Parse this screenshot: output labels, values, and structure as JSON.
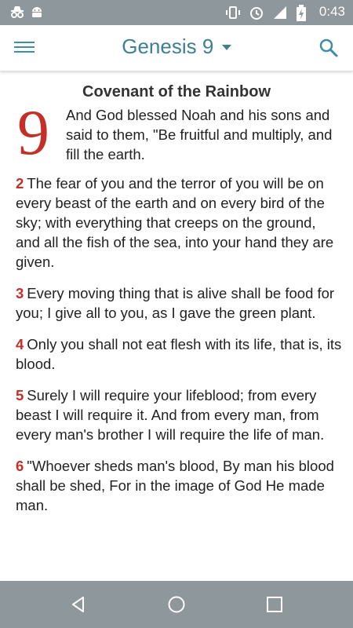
{
  "status_bar": {
    "time": "0:43",
    "left_icons": [
      "incognito-icon",
      "android-icon"
    ],
    "right_icons": [
      "vibrate-icon",
      "alarm-icon",
      "signal-icon",
      "battery-icon"
    ]
  },
  "app_bar": {
    "title": "Genesis 9",
    "menu_icon": "hamburger-menu-icon",
    "search_icon": "search-icon"
  },
  "section": {
    "heading": "Covenant of the Rainbow",
    "chapter_number": "9",
    "first_verse_text": "And God blessed Noah and his sons and said to them, \"Be fruitful and multiply, and fill the earth."
  },
  "verses": [
    {
      "num": "2",
      "text": "The fear of you and the terror of you will be on every beast of the earth and on every bird of the sky; with everything that creeps on the ground, and all the fish of the sea, into your hand they are given."
    },
    {
      "num": "3",
      "text": "Every moving thing that is alive shall be food for you; I give all to you, as I gave the green plant."
    },
    {
      "num": "4",
      "text": "Only you shall not eat flesh with its life, that is, its blood."
    },
    {
      "num": "5",
      "text": "Surely I will require your lifeblood; from every beast I will require it. And from every man, from every man's brother I will require the life of man."
    },
    {
      "num": "6",
      "text": "\"Whoever sheds man's blood, By man his blood shall be shed, For in the image of God He made man."
    }
  ],
  "nav_bar": {
    "back_icon": "back-icon",
    "home_icon": "home-icon",
    "recents_icon": "recents-icon"
  },
  "colors": {
    "accent": "#3f7f92",
    "verse_number": "#c43027",
    "system_bar": "#8e979b"
  }
}
